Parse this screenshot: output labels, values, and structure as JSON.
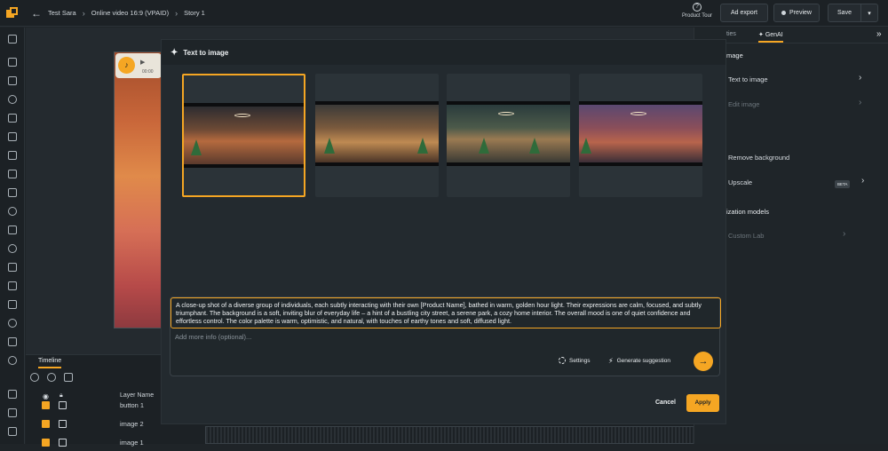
{
  "header": {
    "breadcrumbs": [
      "Test Sara",
      "Online video 16:9 (VPAID)",
      "Story 1"
    ],
    "product_tour": "Product Tour",
    "ad_export": "Ad export",
    "preview": "Preview",
    "save": "Save"
  },
  "audio": {
    "time": "00:00"
  },
  "timeline": {
    "tab": "Timeline",
    "layer_header": "Layer Name",
    "layers": [
      {
        "name": "button 1",
        "checked": true
      },
      {
        "name": "image 2",
        "checked": true
      },
      {
        "name": "image 1",
        "checked": true
      }
    ]
  },
  "right_panel": {
    "tabs": [
      "ties",
      "GenAI"
    ],
    "section_image": "mage",
    "text_to_image": "Text to image",
    "edit_image": "Edit image",
    "remove_background": "Remove background",
    "upscale": "Upscale",
    "beta": "BETA",
    "section_models": "ization models",
    "custom_lab": "Custom Lab"
  },
  "modal": {
    "title": "Text to image",
    "prompt": "A close-up shot of a diverse group of individuals, each subtly interacting with their own [Product Name], bathed in warm, golden hour light. Their expressions are calm, focused, and subtly triumphant. The background is a soft, inviting blur of everyday life – a hint of a bustling city street, a serene park, a cozy home interior. The overall mood is one of quiet confidence and effortless control. The color palette is warm, optimistic, and natural, with touches of earthy tones and soft, diffused light.",
    "more_placeholder": "Add more info (optional)...",
    "settings": "Settings",
    "generate_suggestion": "Generate suggestion",
    "cancel": "Cancel",
    "apply": "Apply",
    "images": [
      "generated-image-1",
      "generated-image-2",
      "generated-image-3",
      "generated-image-4"
    ],
    "selected_index": 0
  },
  "colors": {
    "accent": "#f5a623",
    "bg": "#1f2428"
  }
}
